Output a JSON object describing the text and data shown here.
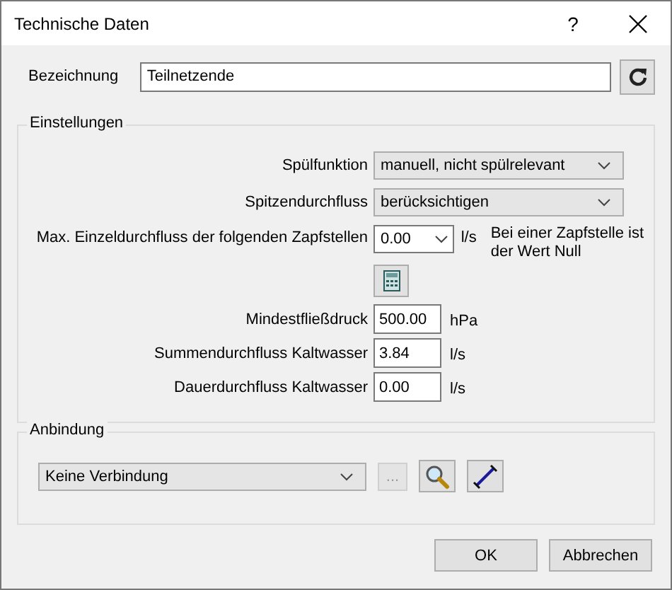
{
  "window": {
    "title": "Technische Daten",
    "help": "?"
  },
  "name": {
    "label": "Bezeichnung",
    "value": "Teilnetzende"
  },
  "settings": {
    "title": "Einstellungen",
    "rows": [
      {
        "kind": "select",
        "label": "Spülfunktion",
        "value": "manuell, nicht spülrelevant"
      },
      {
        "kind": "select",
        "label": "Spitzendurchfluss",
        "value": "berücksichtigen"
      },
      {
        "kind": "combo",
        "label": "Max. Einzeldurchfluss der folgenden Zapfstellen",
        "value": "0.00",
        "unit": "l/s",
        "note": "Bei einer Zapfstelle ist der Wert Null"
      },
      {
        "kind": "calc"
      },
      {
        "kind": "input",
        "label": "Mindestfließdruck",
        "value": "500.00",
        "unit": "hPa"
      },
      {
        "kind": "input",
        "label": "Summendurchfluss Kaltwasser",
        "value": "3.84",
        "unit": "l/s"
      },
      {
        "kind": "input",
        "label": "Dauerdurchfluss Kaltwasser",
        "value": "0.00",
        "unit": "l/s"
      }
    ]
  },
  "connection": {
    "title": "Anbindung",
    "value": "Keine Verbindung",
    "more": {
      "label": "...",
      "disabled": true
    }
  },
  "buttons": [
    "OK",
    "Abbrechen"
  ]
}
